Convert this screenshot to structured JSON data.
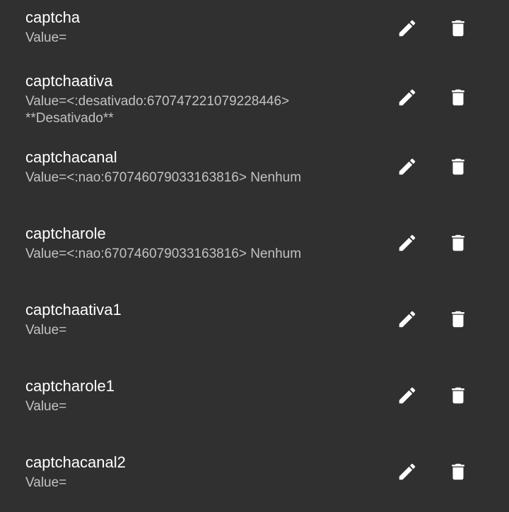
{
  "icons": {
    "edit": "pencil-icon",
    "delete": "trash-icon"
  },
  "colors": {
    "background": "#303030",
    "name_text": "#ffffff",
    "value_text": "#c2c2c2",
    "icon": "#ffffff"
  },
  "items": [
    {
      "name": "captcha",
      "value": "Value="
    },
    {
      "name": "captchaativa",
      "value": "Value=<:desativado:670747221079228446> **Desativado**"
    },
    {
      "name": "captchacanal",
      "value": "Value=<:nao:670746079033163816> Nenhum"
    },
    {
      "name": "captcharole",
      "value": "Value=<:nao:670746079033163816> Nenhum"
    },
    {
      "name": "captchaativa1",
      "value": "Value="
    },
    {
      "name": "captcharole1",
      "value": "Value="
    },
    {
      "name": "captchacanal2",
      "value": "Value="
    }
  ]
}
